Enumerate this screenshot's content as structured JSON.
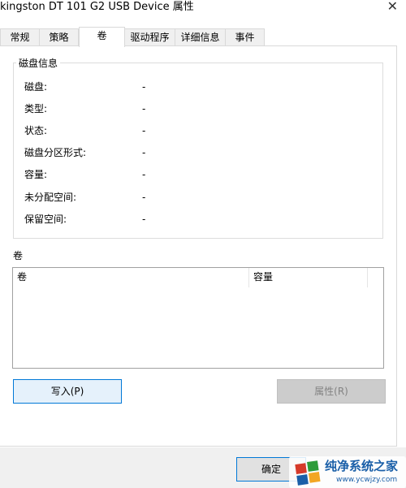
{
  "window": {
    "title": "kingston DT 101 G2 USB Device 属性",
    "close_glyph": "✕"
  },
  "tabs": [
    {
      "label": "常规"
    },
    {
      "label": "策略"
    },
    {
      "label": "卷"
    },
    {
      "label": "驱动程序"
    },
    {
      "label": "详细信息"
    },
    {
      "label": "事件"
    }
  ],
  "disk_info": {
    "group_label": "磁盘信息",
    "rows": [
      {
        "label": "磁盘:",
        "value": "-"
      },
      {
        "label": "类型:",
        "value": "-"
      },
      {
        "label": "状态:",
        "value": "-"
      },
      {
        "label": "磁盘分区形式:",
        "value": "-"
      },
      {
        "label": "容量:",
        "value": "-"
      },
      {
        "label": "未分配空间:",
        "value": "-"
      },
      {
        "label": "保留空间:",
        "value": "-"
      }
    ]
  },
  "volumes": {
    "caption": "卷",
    "columns": [
      "卷",
      "容量"
    ]
  },
  "buttons": {
    "write": "写入(P)",
    "properties": "属性(R)",
    "ok": "确定"
  },
  "watermark": {
    "site": "纯净系统之家",
    "url": "www.ycwjzy.com",
    "colors": [
      "#1a5fa8",
      "#2e9c3a",
      "#f2a623",
      "#d63a2a"
    ]
  }
}
